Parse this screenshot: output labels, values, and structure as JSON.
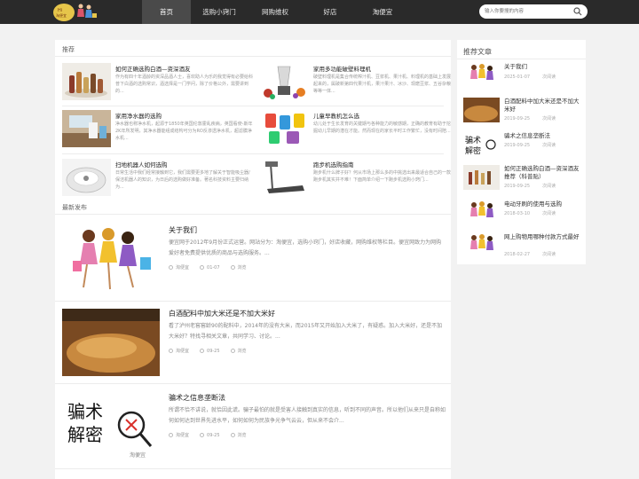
{
  "nav": {
    "logo_text": "Hi 淘便宜",
    "items": [
      {
        "label": "首页"
      },
      {
        "label": "选购小窍门"
      },
      {
        "label": "网购维权"
      },
      {
        "label": "好店"
      },
      {
        "label": "淘便宜"
      }
    ],
    "active_index": 0
  },
  "search": {
    "placeholder": "输入你要搜的内容",
    "icon": "search-icon"
  },
  "recommend": {
    "title": "推荐",
    "items": [
      {
        "title": "如何正确选购白酒—资深酒友",
        "desc": "作为有四十年酒龄的资深品酒人士，喜欢助人为乐的我觉得有必要给科普下白酒的选购常识，酒选择是一门学问，除了价格公外，需要讲到的...",
        "image": "wine-bottles"
      },
      {
        "title": "家用多功能破壁料理机",
        "desc": "破壁料理机是集合传统榨汁机、豆浆机、果汁机、料理机的基础上发展起来的，属破新第四代果汁机，果汁果汁、冰沙、现磨豆浆、五谷杂粮等等一体...",
        "image": "blender"
      },
      {
        "title": "家用净水器的选购",
        "desc": "净水器也称净水机，起源于1850年英国伦敦霍乱疾病，英国看使-斯年2K年所发明，其净水器能组成结构可分为RO反渗透净水机，超滤膜净水机...",
        "image": "water-purifier"
      },
      {
        "title": "儿童早教机怎么选",
        "desc": "幼儿处于生长发育的关键期与各种能力的敏感期，正确的教育有助于挖掘幼儿早期的潜在才能。然而现在的家长平时工作繁忙，没有时间陪...",
        "image": "kids-learning-machine"
      },
      {
        "title": "扫地机器人如何选购",
        "desc": "日常生活中我们经常接触到它，我们需要更多地了解关于智能吸尘器/保洁机器人的知识，为日后的选购做好准备。著名科技资料主要归纳为...",
        "image": "robot-vacuum"
      },
      {
        "title": "跑步机选购指南",
        "desc": "跑步机什么牌子好？何从市场上那么多的中挑选出来最适合自己的一款跑步机其实并不难！下面简单介绍一下跑步机选购小窍门...",
        "image": "treadmill"
      }
    ]
  },
  "latest": {
    "title": "最新发布",
    "posts": [
      {
        "title": "关于我们",
        "desc": "便宜网于2012年9月份正式运营。网站分为：淘便宜，选购小窍门，好店收藏，网购维权等栏目。便宜网致力为网购爱好者免费提供优质的商品与选购服务。...",
        "meta": [
          "淘便宜",
          "01-07",
          "浏览"
        ],
        "image": "shopping-girls"
      },
      {
        "title": "白酒配料中加大米还是不加大米好",
        "desc": "看了泸州老窖窖龄90的配料中，2014年的没有大米，而2015年又开始加入大米了，有疑惑。加入大米好，还是不加大米好？特找寻相关文章，共同学习、讨论。...",
        "meta": [
          "淘便宜",
          "09-25",
          "浏览"
        ],
        "image": "grain-sorghum"
      },
      {
        "title": "骗术之信息垄断法",
        "desc": "所谓不恰不讲说，就恰因此谎。骗子最怕的就是受害人接触到真实的信息，听到不同的声音。所以他们从来只是自称如何如何达到世界先进水平，如何如何为民族争光争气云云，但从来不会介...",
        "meta": [
          "淘便宜",
          "09-25",
          "浏览"
        ],
        "image": "scam-decode",
        "image_text": [
          "骗术",
          "解密",
          "淘便宜"
        ]
      }
    ]
  },
  "sidebar": {
    "title": "推荐文章",
    "items": [
      {
        "title": "关于我们",
        "date": "2025-01-07",
        "reads": "次阅读",
        "image": "shopping-girls"
      },
      {
        "title": "白酒配料中加大米还是不加大米好",
        "date": "2019-09-25",
        "reads": "次阅读",
        "image": "grain-sorghum"
      },
      {
        "title": "骗术之信息垄断法",
        "date": "2019-09-25",
        "reads": "次阅读",
        "image": "scam-decode",
        "image_text": [
          "骗术",
          "解密"
        ]
      },
      {
        "title": "如何正确选购白酒—资深酒友推荐（科普贴）",
        "date": "2019-09-25",
        "reads": "次阅读",
        "image": "wine-bottles"
      },
      {
        "title": "电动牙刷的使用与选购",
        "date": "2018-03-10",
        "reads": "次阅读",
        "image": "shopping-girls"
      },
      {
        "title": "网上购物用哪种付款方式最好",
        "date": "2018-02-27",
        "reads": "次阅读",
        "image": "shopping-girls"
      }
    ]
  },
  "colors": {
    "topbar": "#2a2a2a",
    "nav_active": "#4a4a4a",
    "background": "#f2f2f2",
    "panel": "#ffffff"
  }
}
